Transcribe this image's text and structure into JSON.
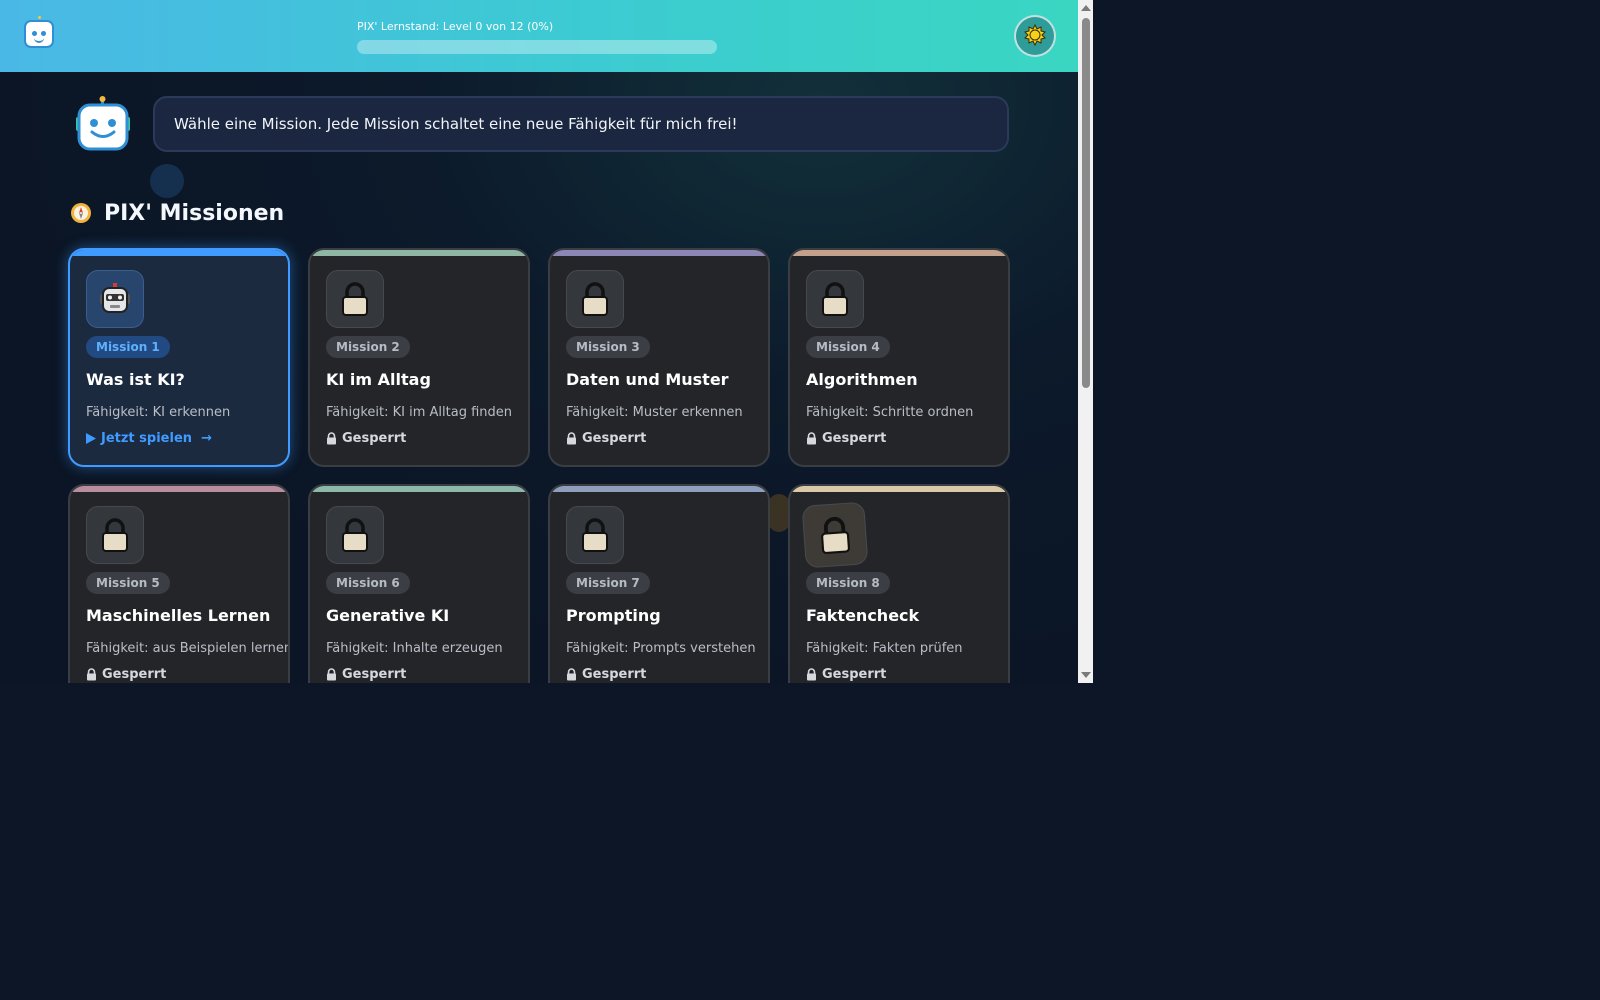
{
  "header": {
    "progress_label": "PIX' Lernstand: Level 0 von 12 (0%)",
    "progress_percent": 0,
    "logo_icon": "robot-icon",
    "theme_icon": "sun-icon"
  },
  "bot": {
    "message": "Wähle eine Mission. Jede Mission schaltet eine neue Fähigkeit für mich frei!"
  },
  "section": {
    "title": "PIX' Missionen",
    "icon": "compass-icon"
  },
  "missions": [
    {
      "badge": "Mission 1",
      "title": "Was ist KI?",
      "skill": "Fähigkeit: KI erkennen",
      "status": "Jetzt spielen  →",
      "status_icon": "play-icon",
      "icon": "robot-icon",
      "state": "active",
      "color": "#3f9bff"
    },
    {
      "badge": "Mission 2",
      "title": "KI im Alltag",
      "skill": "Fähigkeit: KI im Alltag finden",
      "status": "Gesperrt",
      "status_icon": "lock-icon",
      "icon": "lock-icon",
      "state": "locked",
      "color": "#8fb5a5"
    },
    {
      "badge": "Mission 3",
      "title": "Daten und Muster",
      "skill": "Fähigkeit: Muster erkennen",
      "status": "Gesperrt",
      "status_icon": "lock-icon",
      "icon": "lock-icon",
      "state": "locked",
      "color": "#8b86b3"
    },
    {
      "badge": "Mission 4",
      "title": "Algorithmen",
      "skill": "Fähigkeit: Schritte ordnen",
      "status": "Gesperrt",
      "status_icon": "lock-icon",
      "icon": "lock-icon",
      "state": "locked",
      "color": "#c2a28c"
    },
    {
      "badge": "Mission 5",
      "title": "Maschinelles Lernen",
      "skill": "Fähigkeit: aus Beispielen lernen",
      "status": "Gesperrt",
      "status_icon": "lock-icon",
      "icon": "lock-icon",
      "state": "locked",
      "color": "#b88e9e"
    },
    {
      "badge": "Mission 6",
      "title": "Generative KI",
      "skill": "Fähigkeit: Inhalte erzeugen",
      "status": "Gesperrt",
      "status_icon": "lock-icon",
      "icon": "lock-icon",
      "state": "locked",
      "color": "#8db8a9"
    },
    {
      "badge": "Mission 7",
      "title": "Prompting",
      "skill": "Fähigkeit: Prompts verstehen",
      "status": "Gesperrt",
      "status_icon": "lock-icon",
      "icon": "lock-icon",
      "state": "locked",
      "color": "#8e9fbd"
    },
    {
      "badge": "Mission 8",
      "title": "Faktencheck",
      "skill": "Fähigkeit: Fakten prüfen",
      "status": "Gesperrt",
      "status_icon": "lock-icon",
      "icon": "lock-icon",
      "state": "locked",
      "color": "#d9c9a6"
    }
  ]
}
